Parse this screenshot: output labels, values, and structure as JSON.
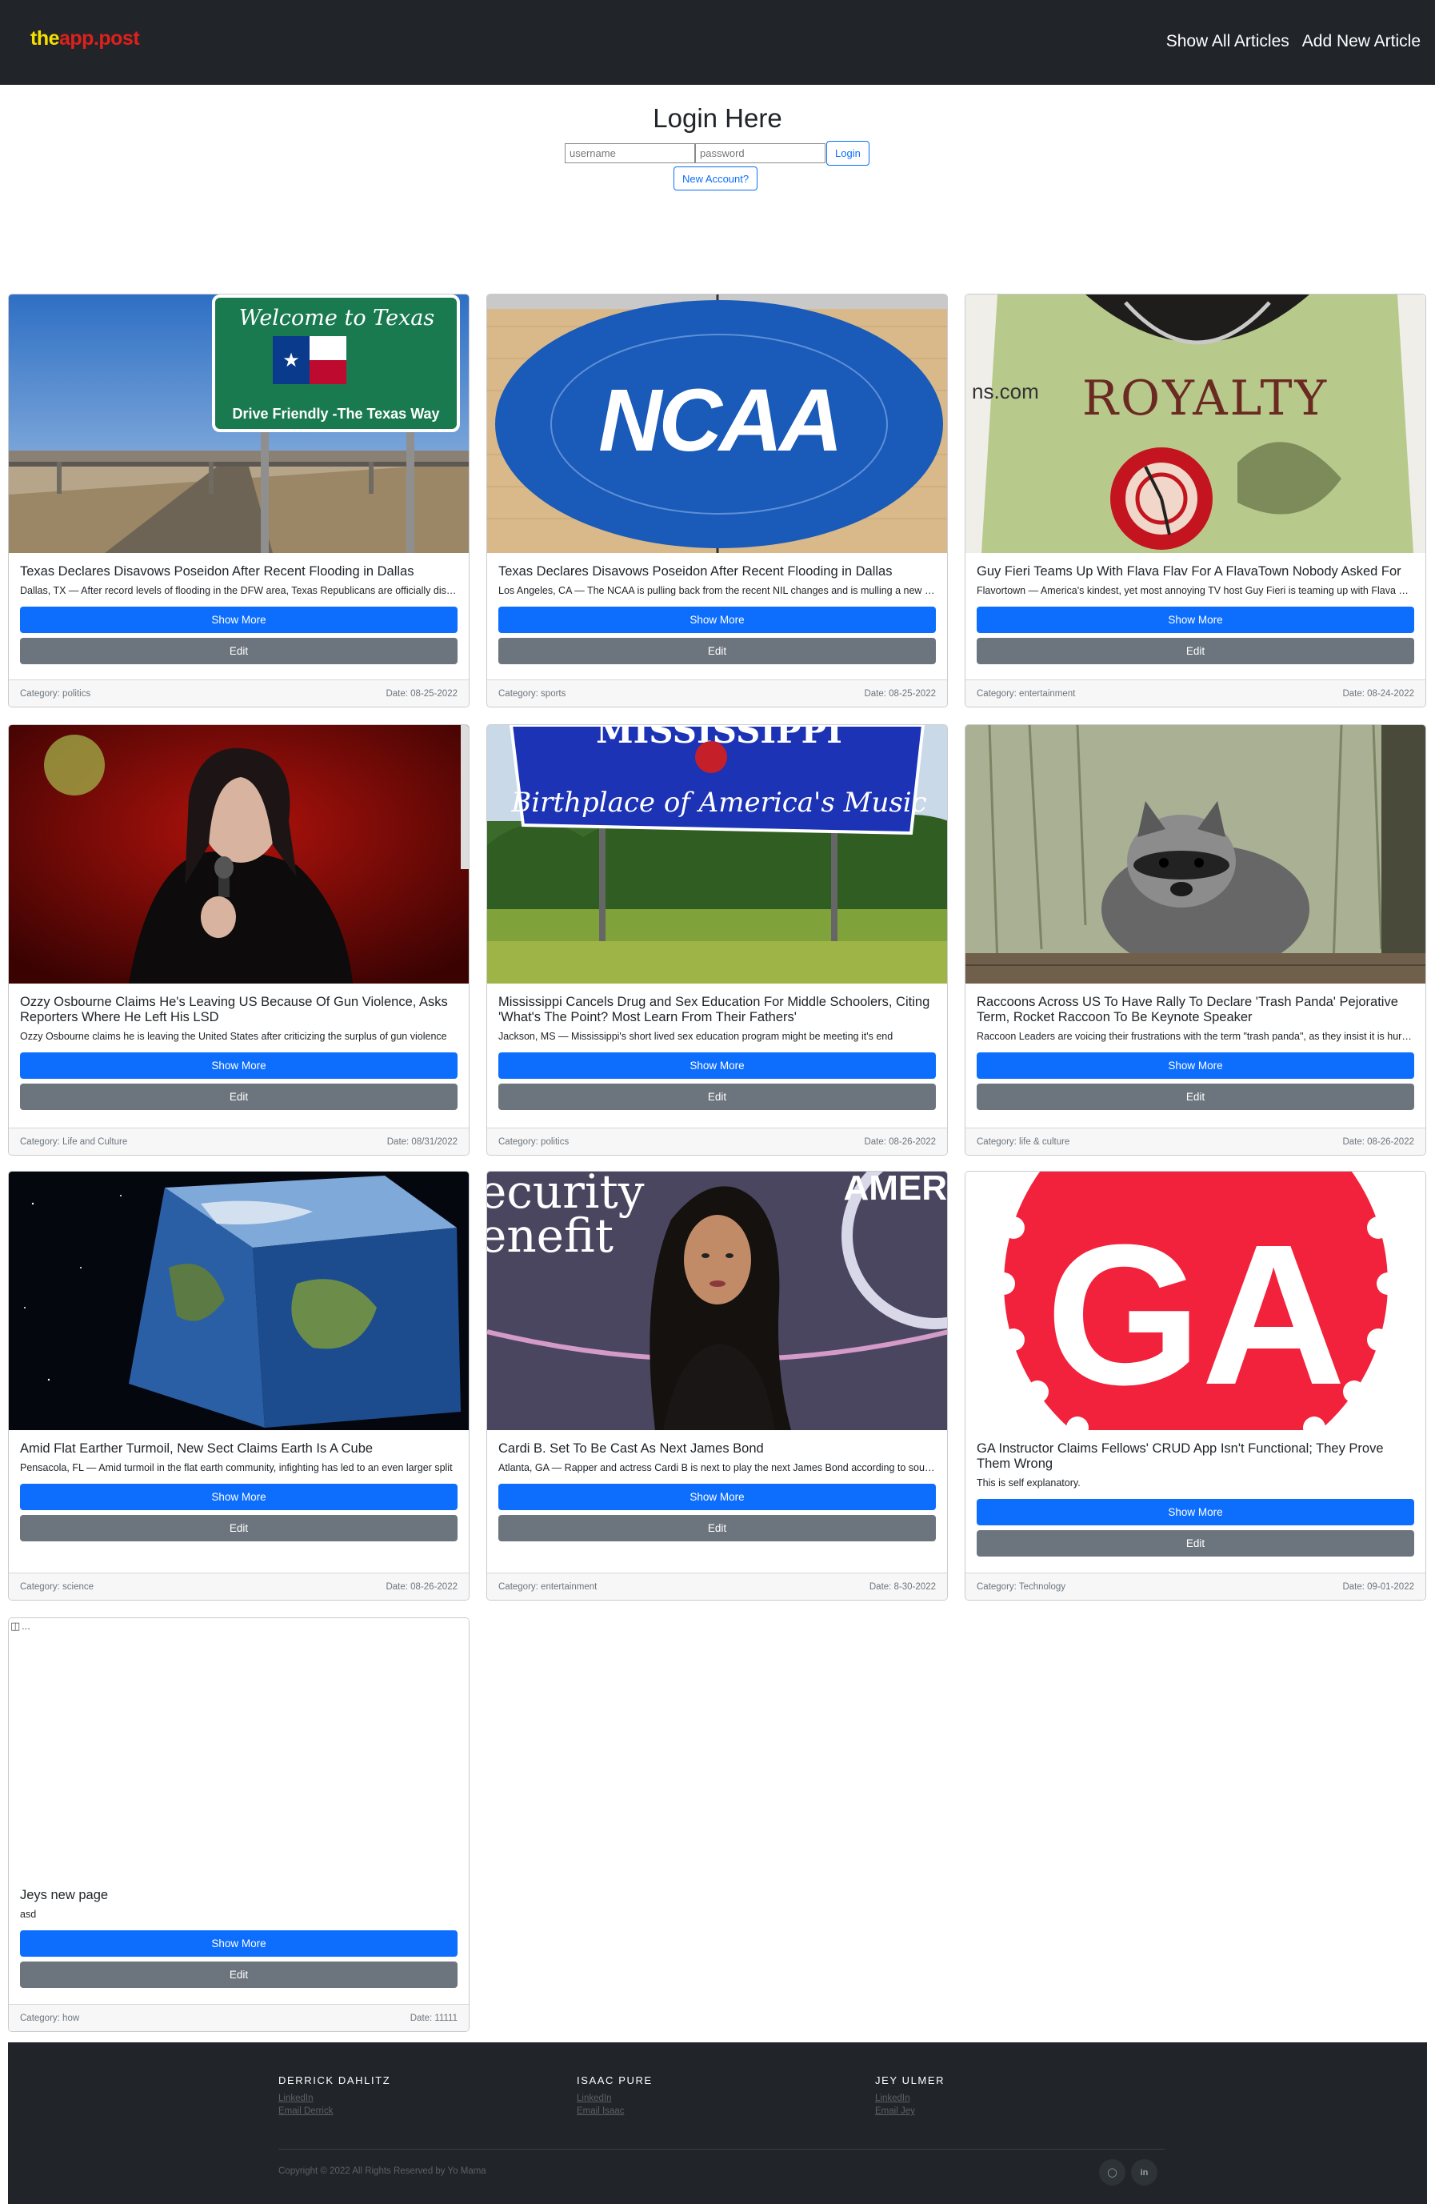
{
  "navbar": {
    "brand_part1": "the",
    "brand_part2": "app.post",
    "links": [
      "Show All Articles",
      "Add New Article"
    ]
  },
  "login": {
    "title": "Login Here",
    "username_placeholder": "username",
    "password_placeholder": "password",
    "login_label": "Login",
    "new_account_label": "New Account?"
  },
  "articles": [
    {
      "title": "Texas Declares Disavows Poseidon After Recent Flooding in Dallas",
      "text": "Dallas, TX — After record levels of flooding in the DFW area, Texas Republicans are officially disavowing Poseidon",
      "category": "Category: politics",
      "date": "Date: 08-25-2022",
      "image": "texas-welcome-sign"
    },
    {
      "title": "Texas Declares Disavows Poseidon After Recent Flooding in Dallas",
      "text": "Los Angeles, CA — The NCAA is pulling back from the recent NIL changes and is mulling a new policy",
      "category": "Category: sports",
      "date": "Date: 08-25-2022",
      "image": "ncaa-court-logo"
    },
    {
      "title": "Guy Fieri Teams Up With Flava Flav For A FlavaTown Nobody Asked For",
      "text": "Flavortown — America's kindest, yet most annoying TV host Guy Fieri is teaming up with Flava Flav",
      "category": "Category: entertainment",
      "date": "Date: 08-24-2022",
      "image": "royalty-shirt-clock"
    },
    {
      "title": "Ozzy Osbourne Claims He's Leaving US Because Of Gun Violence, Asks Reporters Where He Left His LSD",
      "text": "Ozzy Osbourne claims he is leaving the United States after criticizing the surplus of gun violence",
      "category": "Category: Life and Culture",
      "date": "Date: 08/31/2022",
      "image": "singer-on-stage"
    },
    {
      "title": "Mississippi Cancels Drug and Sex Education For Middle Schoolers, Citing 'What's The Point? Most Learn From Their Fathers'",
      "text": "Jackson, MS — Mississippi's short lived sex education program might be meeting it's end",
      "category": "Category: politics",
      "date": "Date: 08-26-2022",
      "image": "mississippi-sign"
    },
    {
      "title": "Raccoons Across US To Have Rally To Declare 'Trash Panda' Pejorative Term, Rocket Raccoon To Be Keynote Speaker",
      "text": "Raccoon Leaders are voicing their frustrations with the term \"trash panda\", as they insist it is hurtful",
      "category": "Category: life & culture",
      "date": "Date: 08-26-2022",
      "image": "raccoon"
    },
    {
      "title": "Amid Flat Earther Turmoil, New Sect Claims Earth Is A Cube",
      "text": "Pensacola, FL — Amid turmoil in the flat earth community, infighting has led to an even larger split",
      "category": "Category: science",
      "date": "Date: 08-26-2022",
      "image": "cube-earth"
    },
    {
      "title": "Cardi B. Set To Be Cast As Next James Bond",
      "text": "Atlanta, GA — Rapper and actress Cardi B is next to play the next James Bond according to sources",
      "category": "Category: entertainment",
      "date": "Date: 8-30-2022",
      "image": "red-carpet-portrait"
    },
    {
      "title": "GA Instructor Claims Fellows' CRUD App Isn't Functional; They Prove Them Wrong",
      "text": "This is self explanatory.",
      "category": "Category: Technology",
      "date": "Date: 09-01-2022",
      "image": "ga-logo",
      "ga_text": "GA"
    },
    {
      "title": "Jeys new page",
      "text": "asd",
      "category": "Category: how",
      "date": "Date: 11111",
      "image": "broken-image",
      "alt": "..."
    }
  ],
  "card_buttons": {
    "show_more": "Show More",
    "edit": "Edit"
  },
  "footer": {
    "authors": [
      {
        "name": "DERRICK DAHLITZ",
        "links": [
          "LinkedIn",
          "Email Derrick"
        ]
      },
      {
        "name": "ISAAC PURE",
        "links": [
          "LinkedIn",
          "Email Isaac"
        ]
      },
      {
        "name": "JEY ULMER",
        "links": [
          "LinkedIn",
          "Email Jey"
        ]
      }
    ],
    "copyright": "Copyright © 2022 All Rights Reserved by Yo Mama",
    "icons": [
      "github-icon",
      "linkedin-icon"
    ],
    "icon_glyphs": [
      "◯",
      "in"
    ]
  },
  "colors": {
    "navbar": "#212529",
    "primary": "#0d6efd",
    "secondary": "#6c757d",
    "brand_yellow": "#f5e000",
    "brand_red": "#e0201c"
  }
}
